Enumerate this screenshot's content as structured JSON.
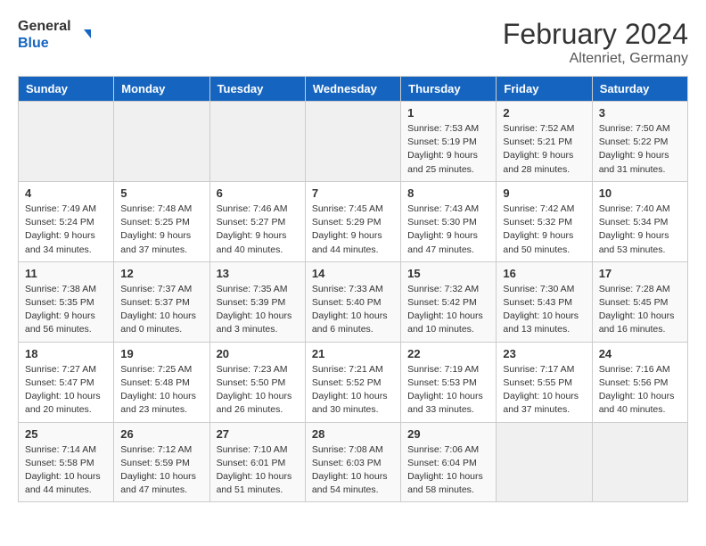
{
  "logo": {
    "line1": "General",
    "line2": "Blue"
  },
  "title": "February 2024",
  "location": "Altenriet, Germany",
  "weekdays": [
    "Sunday",
    "Monday",
    "Tuesday",
    "Wednesday",
    "Thursday",
    "Friday",
    "Saturday"
  ],
  "weeks": [
    [
      {
        "day": "",
        "info": ""
      },
      {
        "day": "",
        "info": ""
      },
      {
        "day": "",
        "info": ""
      },
      {
        "day": "",
        "info": ""
      },
      {
        "day": "1",
        "info": "Sunrise: 7:53 AM\nSunset: 5:19 PM\nDaylight: 9 hours\nand 25 minutes."
      },
      {
        "day": "2",
        "info": "Sunrise: 7:52 AM\nSunset: 5:21 PM\nDaylight: 9 hours\nand 28 minutes."
      },
      {
        "day": "3",
        "info": "Sunrise: 7:50 AM\nSunset: 5:22 PM\nDaylight: 9 hours\nand 31 minutes."
      }
    ],
    [
      {
        "day": "4",
        "info": "Sunrise: 7:49 AM\nSunset: 5:24 PM\nDaylight: 9 hours\nand 34 minutes."
      },
      {
        "day": "5",
        "info": "Sunrise: 7:48 AM\nSunset: 5:25 PM\nDaylight: 9 hours\nand 37 minutes."
      },
      {
        "day": "6",
        "info": "Sunrise: 7:46 AM\nSunset: 5:27 PM\nDaylight: 9 hours\nand 40 minutes."
      },
      {
        "day": "7",
        "info": "Sunrise: 7:45 AM\nSunset: 5:29 PM\nDaylight: 9 hours\nand 44 minutes."
      },
      {
        "day": "8",
        "info": "Sunrise: 7:43 AM\nSunset: 5:30 PM\nDaylight: 9 hours\nand 47 minutes."
      },
      {
        "day": "9",
        "info": "Sunrise: 7:42 AM\nSunset: 5:32 PM\nDaylight: 9 hours\nand 50 minutes."
      },
      {
        "day": "10",
        "info": "Sunrise: 7:40 AM\nSunset: 5:34 PM\nDaylight: 9 hours\nand 53 minutes."
      }
    ],
    [
      {
        "day": "11",
        "info": "Sunrise: 7:38 AM\nSunset: 5:35 PM\nDaylight: 9 hours\nand 56 minutes."
      },
      {
        "day": "12",
        "info": "Sunrise: 7:37 AM\nSunset: 5:37 PM\nDaylight: 10 hours\nand 0 minutes."
      },
      {
        "day": "13",
        "info": "Sunrise: 7:35 AM\nSunset: 5:39 PM\nDaylight: 10 hours\nand 3 minutes."
      },
      {
        "day": "14",
        "info": "Sunrise: 7:33 AM\nSunset: 5:40 PM\nDaylight: 10 hours\nand 6 minutes."
      },
      {
        "day": "15",
        "info": "Sunrise: 7:32 AM\nSunset: 5:42 PM\nDaylight: 10 hours\nand 10 minutes."
      },
      {
        "day": "16",
        "info": "Sunrise: 7:30 AM\nSunset: 5:43 PM\nDaylight: 10 hours\nand 13 minutes."
      },
      {
        "day": "17",
        "info": "Sunrise: 7:28 AM\nSunset: 5:45 PM\nDaylight: 10 hours\nand 16 minutes."
      }
    ],
    [
      {
        "day": "18",
        "info": "Sunrise: 7:27 AM\nSunset: 5:47 PM\nDaylight: 10 hours\nand 20 minutes."
      },
      {
        "day": "19",
        "info": "Sunrise: 7:25 AM\nSunset: 5:48 PM\nDaylight: 10 hours\nand 23 minutes."
      },
      {
        "day": "20",
        "info": "Sunrise: 7:23 AM\nSunset: 5:50 PM\nDaylight: 10 hours\nand 26 minutes."
      },
      {
        "day": "21",
        "info": "Sunrise: 7:21 AM\nSunset: 5:52 PM\nDaylight: 10 hours\nand 30 minutes."
      },
      {
        "day": "22",
        "info": "Sunrise: 7:19 AM\nSunset: 5:53 PM\nDaylight: 10 hours\nand 33 minutes."
      },
      {
        "day": "23",
        "info": "Sunrise: 7:17 AM\nSunset: 5:55 PM\nDaylight: 10 hours\nand 37 minutes."
      },
      {
        "day": "24",
        "info": "Sunrise: 7:16 AM\nSunset: 5:56 PM\nDaylight: 10 hours\nand 40 minutes."
      }
    ],
    [
      {
        "day": "25",
        "info": "Sunrise: 7:14 AM\nSunset: 5:58 PM\nDaylight: 10 hours\nand 44 minutes."
      },
      {
        "day": "26",
        "info": "Sunrise: 7:12 AM\nSunset: 5:59 PM\nDaylight: 10 hours\nand 47 minutes."
      },
      {
        "day": "27",
        "info": "Sunrise: 7:10 AM\nSunset: 6:01 PM\nDaylight: 10 hours\nand 51 minutes."
      },
      {
        "day": "28",
        "info": "Sunrise: 7:08 AM\nSunset: 6:03 PM\nDaylight: 10 hours\nand 54 minutes."
      },
      {
        "day": "29",
        "info": "Sunrise: 7:06 AM\nSunset: 6:04 PM\nDaylight: 10 hours\nand 58 minutes."
      },
      {
        "day": "",
        "info": ""
      },
      {
        "day": "",
        "info": ""
      }
    ]
  ]
}
